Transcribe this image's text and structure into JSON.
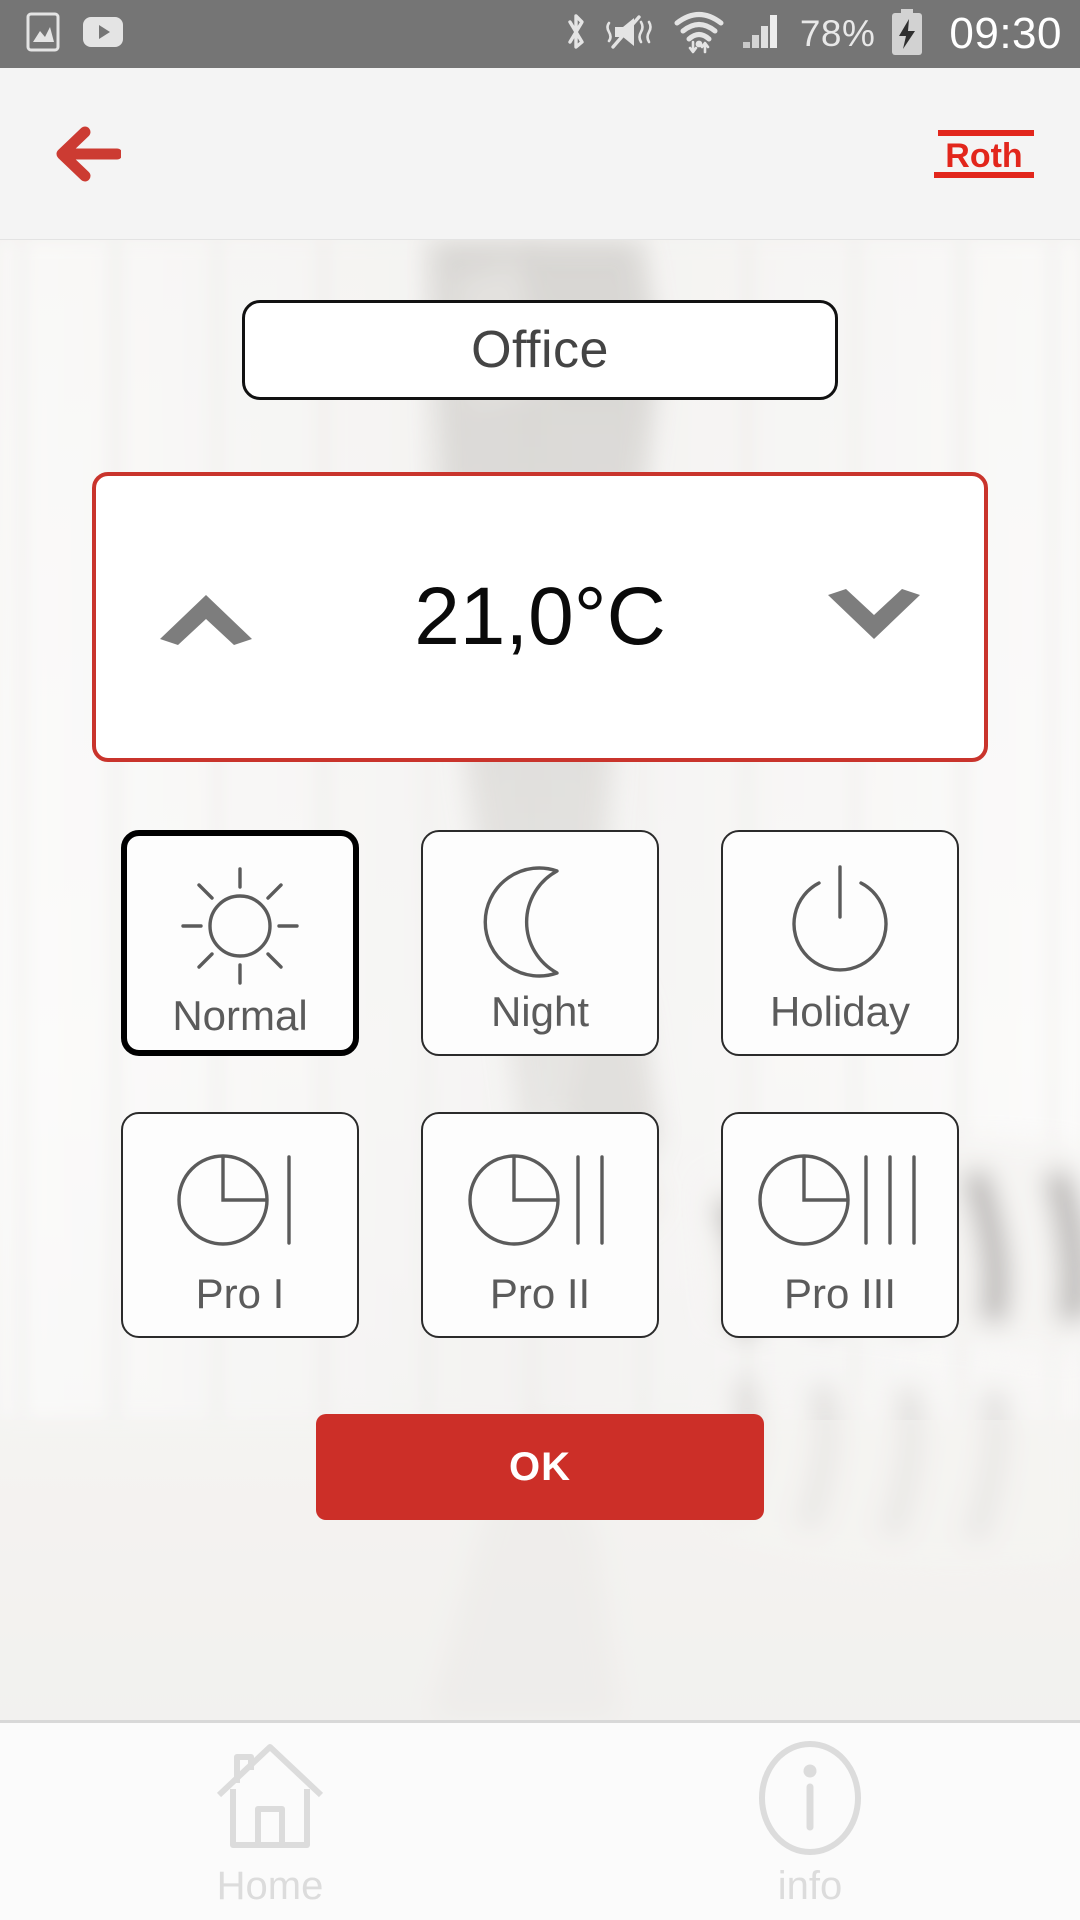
{
  "status_bar": {
    "background_color": "#757575",
    "left_icons": [
      "image-icon",
      "youtube-icon"
    ],
    "right_icons": [
      "bluetooth-icon",
      "silent-vibrate-icon",
      "wifi-icon",
      "signal-icon"
    ],
    "battery_percent": "78%",
    "battery_state": "charging",
    "clock": "09:30"
  },
  "app_bar": {
    "back_icon": "back-arrow-icon",
    "logo_text": "Roth",
    "accent_color": "#cc2f28"
  },
  "room": {
    "name": "Office"
  },
  "temperature": {
    "value": "21,0°C",
    "increase_icon": "chevron-up-icon",
    "decrease_icon": "chevron-down-icon",
    "border_color": "#c9342c"
  },
  "modes": [
    {
      "label": "Normal",
      "icon": "sun-icon",
      "selected": true
    },
    {
      "label": "Night",
      "icon": "moon-icon",
      "selected": false
    },
    {
      "label": "Holiday",
      "icon": "power-icon",
      "selected": false
    },
    {
      "label": "Pro I",
      "icon": "pie-1bar-icon",
      "selected": false
    },
    {
      "label": "Pro II",
      "icon": "pie-2bar-icon",
      "selected": false
    },
    {
      "label": "Pro III",
      "icon": "pie-3bar-icon",
      "selected": false
    }
  ],
  "confirm": {
    "label": "OK",
    "color": "#cc2f28"
  },
  "bottom_nav": [
    {
      "label": "Home",
      "icon": "home-icon"
    },
    {
      "label": "info",
      "icon": "info-icon"
    }
  ]
}
